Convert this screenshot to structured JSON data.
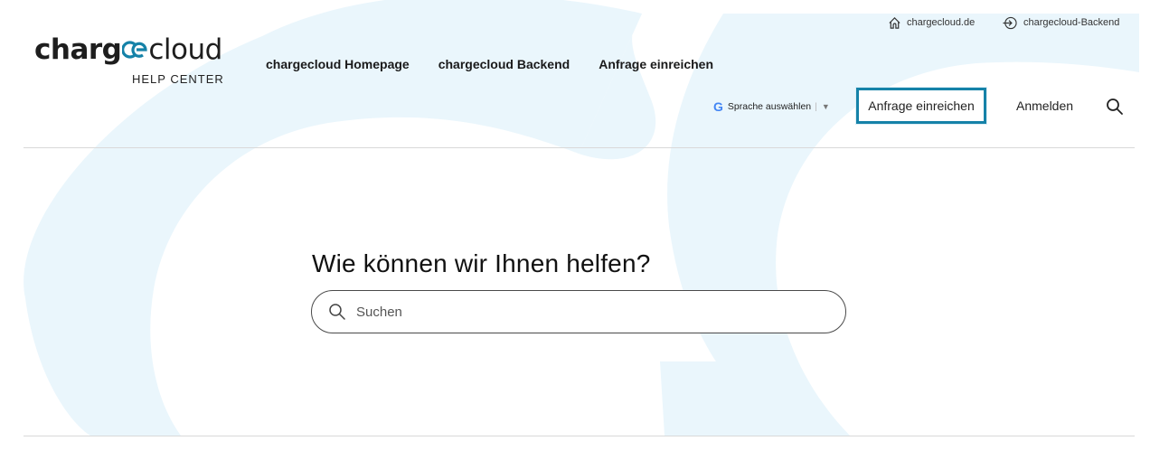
{
  "brand": {
    "logo_bold": "charg",
    "logo_light": "cloud",
    "logo_sub": "HELP CENTER",
    "accent_color": "#1582a8",
    "background_shape_color": "#eaf6fc"
  },
  "utility_links": {
    "home_label": "chargecloud.de",
    "backend_label": "chargecloud-Backend"
  },
  "main_nav": [
    "chargecloud Homepage",
    "chargecloud Backend",
    "Anfrage einreichen"
  ],
  "language": {
    "google_g": "G",
    "label": "Sprache auswählen",
    "separator": "|",
    "arrow": "▼"
  },
  "header_actions": {
    "request_button": "Anfrage einreichen",
    "login_button": "Anmelden"
  },
  "hero": {
    "title": "Wie können wir Ihnen helfen?",
    "search_placeholder": "Suchen"
  }
}
